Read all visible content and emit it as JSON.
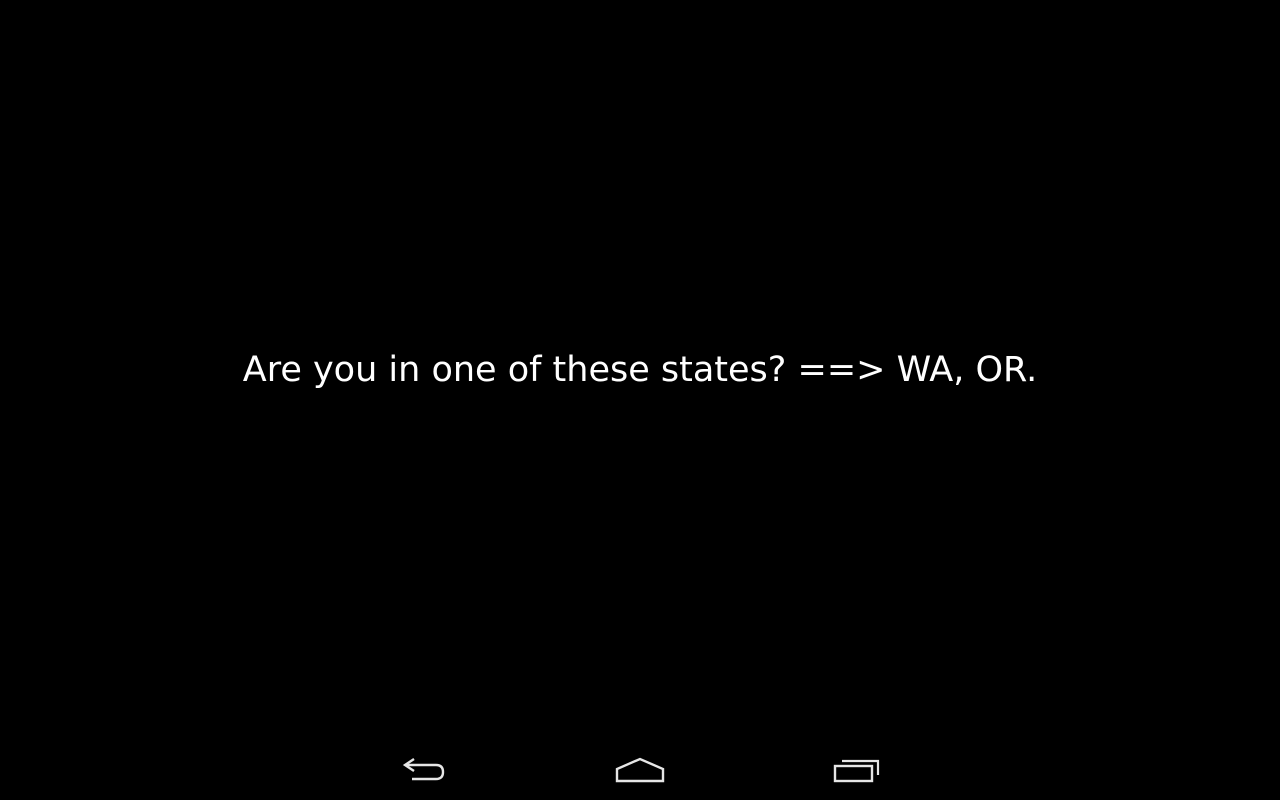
{
  "message": {
    "text": "Are you in one of these states? ==> WA, OR."
  },
  "navbar": {
    "buttons": [
      {
        "icon": "back-icon"
      },
      {
        "icon": "home-icon"
      },
      {
        "icon": "recents-icon"
      }
    ],
    "icon_color": "#e6e6e6"
  },
  "colors": {
    "background": "#000000",
    "text": "#ffffff"
  }
}
